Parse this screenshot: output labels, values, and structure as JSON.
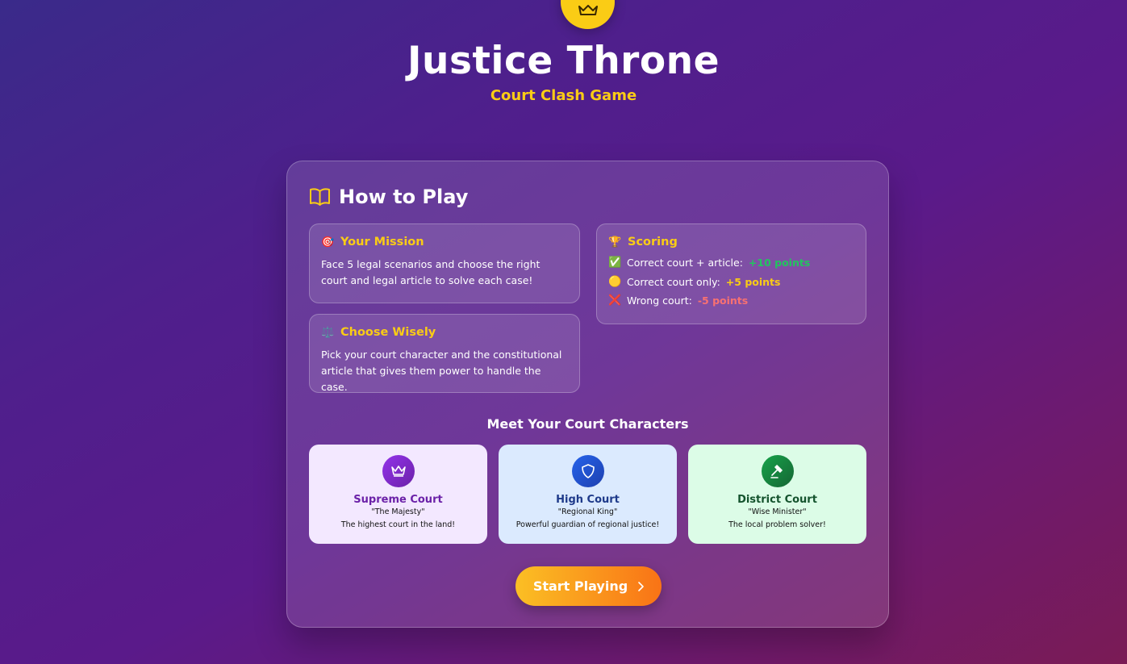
{
  "app": {
    "title": "Justice Throne",
    "subtitle": "Court Clash Game",
    "logo_icon": "crown-icon"
  },
  "how_to_play": {
    "title": "How to Play",
    "icon": "book-icon",
    "mission": {
      "emoji": "🎯",
      "title": "Your Mission",
      "text": "Face 5 legal scenarios and choose the right court and legal article to solve each case!"
    },
    "choose": {
      "emoji": "⚖️",
      "title": "Choose Wisely",
      "text": "Pick your court character and the constitutional article that gives them power to handle the case."
    },
    "scoring": {
      "emoji": "🏆",
      "title": "Scoring",
      "lines": [
        {
          "emoji": "✅",
          "label": "Correct court + article:",
          "points": "+10 points"
        },
        {
          "emoji": "🟡",
          "label": "Correct court only:",
          "points": "+5 points"
        },
        {
          "emoji": "❌",
          "label": "Wrong court:",
          "points": "-5 points"
        }
      ]
    }
  },
  "characters": {
    "title": "Meet Your Court Characters",
    "items": [
      {
        "name": "Supreme Court",
        "nickname": "\"The Majesty\"",
        "description": "The highest court in the land!",
        "icon": "crown-icon",
        "color": "#7e22ce",
        "bg": "#f3e8ff"
      },
      {
        "name": "High Court",
        "nickname": "\"Regional King\"",
        "description": "Powerful guardian of regional justice!",
        "icon": "shield-icon",
        "color": "#1d4ed8",
        "bg": "#dbeafe"
      },
      {
        "name": "District Court",
        "nickname": "\"Wise Minister\"",
        "description": "The local problem solver!",
        "icon": "gavel-icon",
        "color": "#15803d",
        "bg": "#dcfce7"
      }
    ]
  },
  "start_button": {
    "label": "Start Playing",
    "icon": "chevron-right-icon"
  },
  "colors": {
    "accent": "#facc15",
    "positive": "#22c55e",
    "negative": "#f87171"
  }
}
